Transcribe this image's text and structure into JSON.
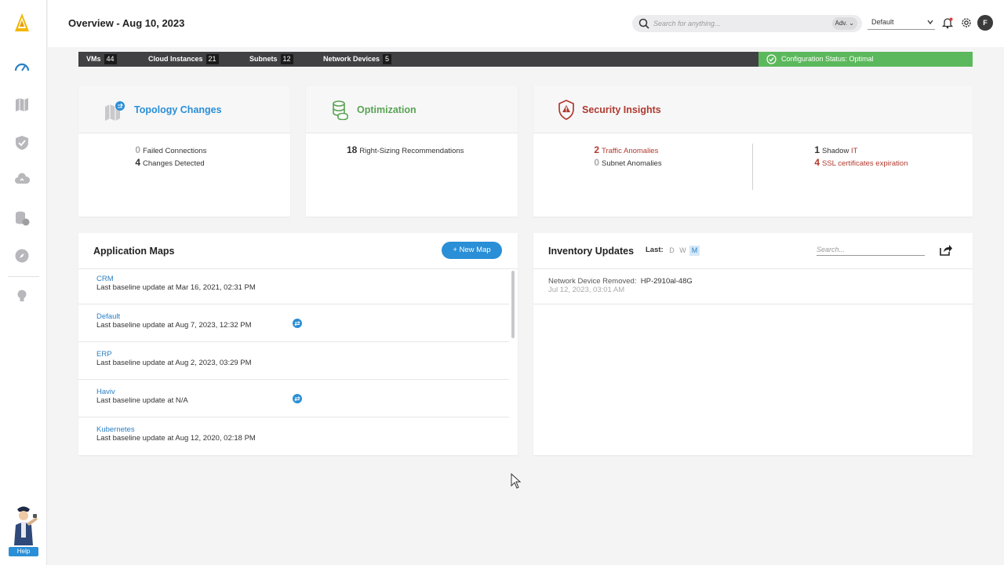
{
  "header": {
    "title": "Overview - Aug 10, 2023",
    "search_placeholder": "Search for anything...",
    "adv_label": "Adv.",
    "workspace": "Default",
    "avatar_initial": "F"
  },
  "sidebar": {
    "items": [
      "dashboard-gauge-icon",
      "map-icon",
      "shield-icon",
      "cloud-upload-icon",
      "database-cost-icon",
      "compass-icon",
      "lightbulb-icon"
    ],
    "help_label": "Help"
  },
  "status_bar": {
    "stats": [
      {
        "label": "VMs",
        "count": "44"
      },
      {
        "label": "Cloud Instances",
        "count": "21"
      },
      {
        "label": "Subnets",
        "count": "12"
      },
      {
        "label": "Network Devices",
        "count": "5"
      }
    ],
    "config_status": "Configuration Status: Optimal"
  },
  "topology": {
    "title": "Topology Changes",
    "metrics": [
      {
        "value": "0",
        "label": "Failed Connections"
      },
      {
        "value": "4",
        "label": "Changes Detected"
      }
    ]
  },
  "optimization": {
    "title": "Optimization",
    "metrics": [
      {
        "value": "18",
        "label": "Right-Sizing Recommendations"
      }
    ]
  },
  "security": {
    "title": "Security Insights",
    "left": [
      {
        "value": "2",
        "label": "Traffic Anomalies"
      },
      {
        "value": "0",
        "label": "Subnet Anomalies"
      }
    ],
    "right": [
      {
        "value": "1",
        "label_a": "Shadow ",
        "label_b": "IT"
      },
      {
        "value": "4",
        "label": "SSL certificates expiration"
      }
    ]
  },
  "app_maps": {
    "title": "Application Maps",
    "new_button": "+ New Map",
    "rows": [
      {
        "name": "CRM",
        "detail": "Last baseline update at Mar 16, 2021, 02:31 PM",
        "sync": false
      },
      {
        "name": "Default",
        "detail": "Last baseline update at Aug 7, 2023, 12:32 PM",
        "sync": true
      },
      {
        "name": "ERP",
        "detail": "Last baseline update at Aug 2, 2023, 03:29 PM",
        "sync": false
      },
      {
        "name": "Haviv",
        "detail": "Last baseline update at N/A",
        "sync": true
      },
      {
        "name": "Kubernetes",
        "detail": "Last baseline update at Aug 12, 2020, 02:18 PM",
        "sync": false
      }
    ]
  },
  "inventory": {
    "title": "Inventory Updates",
    "last_label": "Last:",
    "ranges": [
      "D",
      "W",
      "M"
    ],
    "selected_range": "M",
    "search_placeholder": "Search...",
    "rows": [
      {
        "label": "Network Device Removed:",
        "value": "HP-2910al-48G",
        "time": "Jul 12, 2023, 03:01 AM"
      }
    ]
  },
  "colors": {
    "accent_blue": "#2a8fd6",
    "optimization_green": "#5aa454",
    "security_red": "#b03a2e",
    "status_green": "#5cb85c"
  }
}
